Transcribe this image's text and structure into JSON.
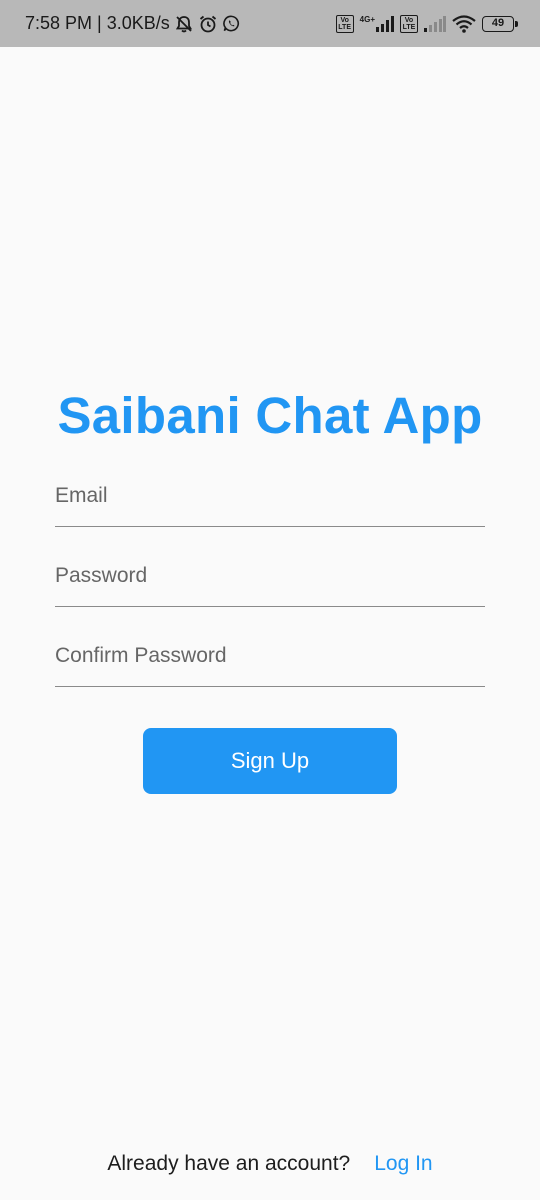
{
  "status_bar": {
    "time": "7:58 PM",
    "net_speed": "3.0KB/s",
    "volte_1": "Vo\nLTE",
    "network_type": "4G+",
    "volte_2": "Vo\nLTE",
    "battery": "49",
    "icons": [
      "mute-icon",
      "alarm-icon",
      "whatsapp-icon",
      "signal-icon",
      "wifi-icon",
      "battery-icon"
    ]
  },
  "app": {
    "title": "Saibani Chat App",
    "accent_color": "#2196f3"
  },
  "form": {
    "email_placeholder": "Email",
    "password_placeholder": "Password",
    "confirm_placeholder": "Confirm Password",
    "signup_label": "Sign Up"
  },
  "footer": {
    "question": "Already have an account?",
    "login_label": "Log In"
  }
}
